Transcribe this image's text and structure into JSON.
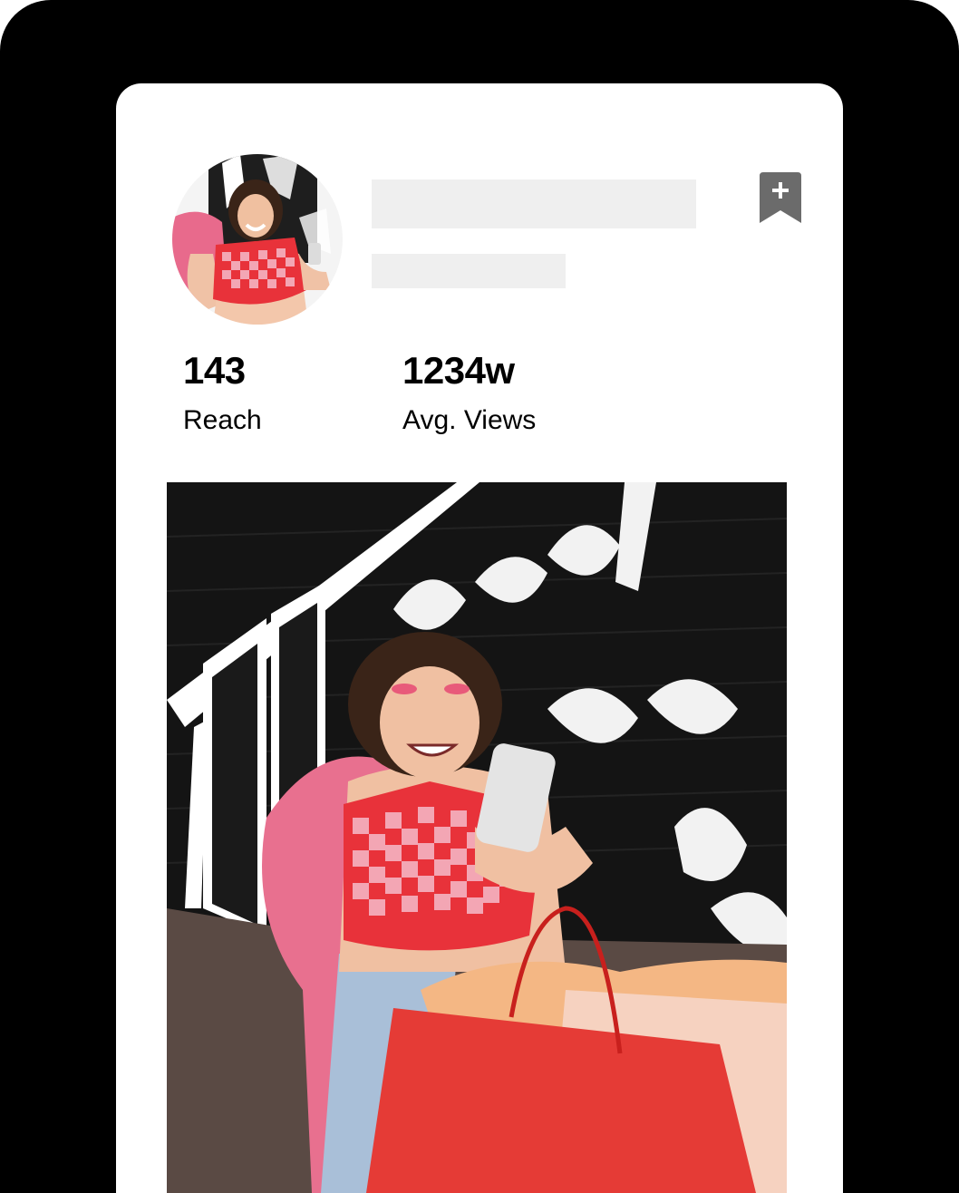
{
  "profile": {
    "avatar_alt": "creator-avatar",
    "bookmark_icon": "bookmark-plus-icon"
  },
  "stats": [
    {
      "value": "143",
      "label": "Reach"
    },
    {
      "value": "1234w",
      "label": "Avg. Views"
    }
  ],
  "post": {
    "image_alt": "creator-post-photo"
  },
  "colors": {
    "frame": "#000000",
    "card": "#ffffff",
    "skeleton": "#efefef",
    "bookmark": "#6b6b6b",
    "top_red": "#e8323a",
    "top_pink": "#f3a6b4",
    "bag_red": "#e53b36"
  }
}
